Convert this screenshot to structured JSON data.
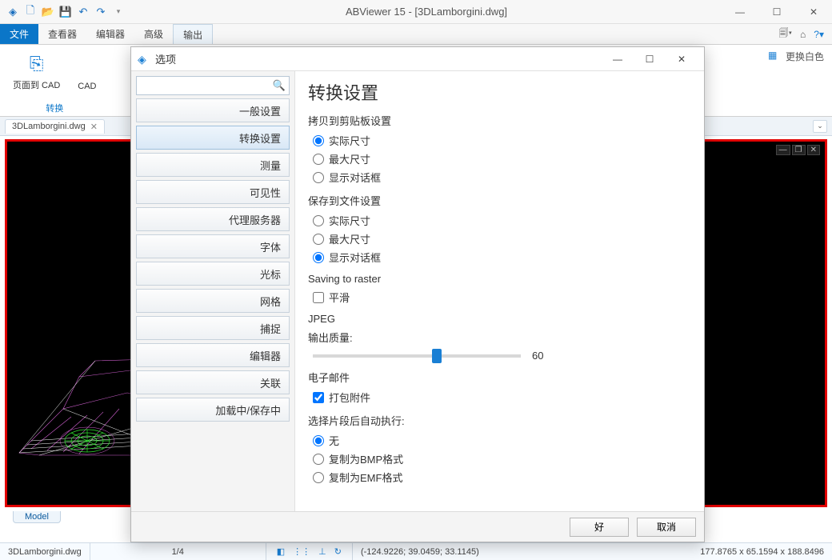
{
  "window": {
    "title": "ABViewer 15 - [3DLamborgini.dwg]"
  },
  "tabs": {
    "items": [
      "文件",
      "查看器",
      "编辑器",
      "高级",
      "输出"
    ],
    "active_index": 0
  },
  "ribbon": {
    "page_to_cad": "页面到 CAD",
    "cad": "CAD",
    "convert_group": "转换",
    "replace_white": "更换白色"
  },
  "doctab": {
    "name": "3DLamborgini.dwg"
  },
  "model_tab": "Model",
  "statusbar": {
    "file": "3DLamborgini.dwg",
    "page": "1/4",
    "coords": "(-124.9226; 39.0459; 33.1145)",
    "dims": "177.8765 x 65.1594 x 188.8496"
  },
  "dialog": {
    "title": "选项",
    "search_placeholder": "",
    "categories": [
      "一般设置",
      "转换设置",
      "测量",
      "可见性",
      "代理服务器",
      "字体",
      "光标",
      "网格",
      "捕捉",
      "编辑器",
      "关联",
      "加载中/保存中"
    ],
    "selected_index": 1,
    "page_title": "转换设置",
    "clipboard": {
      "heading": "拷贝到剪贴板设置",
      "options": [
        "实际尺寸",
        "最大尺寸",
        "显示对话框"
      ],
      "selected": 0
    },
    "savefile": {
      "heading": "保存到文件设置",
      "options": [
        "实际尺寸",
        "最大尺寸",
        "显示对话框"
      ],
      "selected": 2
    },
    "raster": {
      "heading": "Saving to raster",
      "smooth_label": "平滑",
      "smooth_checked": false
    },
    "jpeg": {
      "heading": "JPEG",
      "quality_label": "输出质量:",
      "quality_value": 60
    },
    "email": {
      "heading": "电子邮件",
      "pack_label": "打包附件",
      "pack_checked": true
    },
    "afterselect": {
      "heading": "选择片段后自动执行:",
      "options": [
        "无",
        "复制为BMP格式",
        "复制为EMF格式"
      ],
      "selected": 0
    },
    "ok": "好",
    "cancel": "取消"
  }
}
